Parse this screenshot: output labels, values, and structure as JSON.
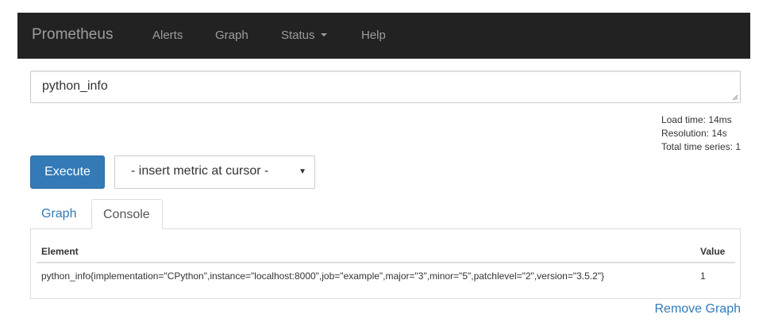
{
  "navbar": {
    "brand": "Prometheus",
    "items": [
      {
        "label": "Alerts"
      },
      {
        "label": "Graph"
      },
      {
        "label": "Status"
      },
      {
        "label": "Help"
      }
    ]
  },
  "query": {
    "expression": "python_info"
  },
  "stats": {
    "load_time": "Load time: 14ms",
    "resolution": "Resolution: 14s",
    "total_series": "Total time series: 1"
  },
  "controls": {
    "execute_label": "Execute",
    "metric_select_value": "- insert metric at cursor -"
  },
  "tabs": [
    {
      "label": "Graph",
      "active": false
    },
    {
      "label": "Console",
      "active": true
    }
  ],
  "console_table": {
    "headers": [
      "Element",
      "Value"
    ],
    "rows": [
      {
        "element": "python_info{implementation=\"CPython\",instance=\"localhost:8000\",job=\"example\",major=\"3\",minor=\"5\",patchlevel=\"2\",version=\"3.5.2\"}",
        "value": "1"
      }
    ]
  },
  "remove_graph_label": "Remove Graph",
  "colors": {
    "navbar_bg": "#222222",
    "navbar_text": "#9d9d9d",
    "primary": "#337ab7",
    "link": "#337ab7",
    "border": "#dddddd"
  }
}
